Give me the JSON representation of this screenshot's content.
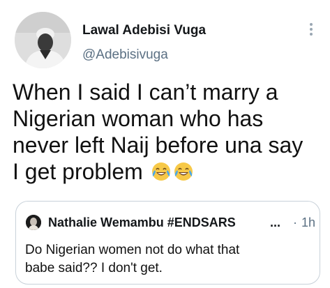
{
  "tweet": {
    "author": {
      "display_name": "Lawal Adebisi Vuga",
      "handle": "@Adebisivuga",
      "avatar_icon": "profile-photo"
    },
    "menu_icon": "vertical-dots-icon",
    "text_lines": [
      "When I said I can’t marry a",
      "Nigerian woman who has",
      "never left Naij before una say",
      "I get problem"
    ],
    "emojis": [
      "face-with-tears-of-joy",
      "face-with-tears-of-joy"
    ]
  },
  "quoted_tweet": {
    "author": {
      "display_name": "Nathalie Wemambu #ENDSARS",
      "truncation": "...",
      "avatar_icon": "profile-photo"
    },
    "separator": "·",
    "time": "1h",
    "text_lines": [
      "Do Nigerian women not do what that",
      "babe said?? I don't get."
    ]
  },
  "colors": {
    "text": "#0f1419",
    "secondary": "#5b7083",
    "border": "#c8d1d9",
    "emoji_yellow": "#f7c948"
  }
}
